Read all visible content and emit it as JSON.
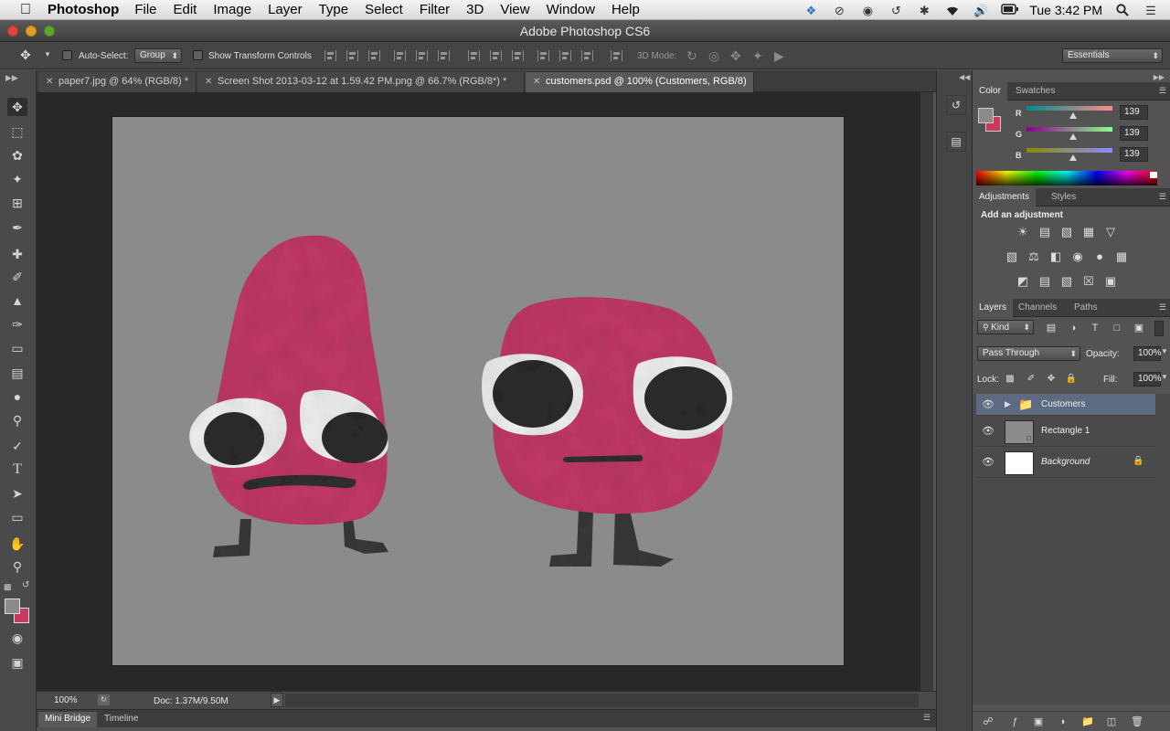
{
  "menubar": {
    "app_name": "Photoshop",
    "items": [
      "File",
      "Edit",
      "Image",
      "Layer",
      "Type",
      "Select",
      "Filter",
      "3D",
      "View",
      "Window",
      "Help"
    ],
    "clock": "Tue 3:42 PM"
  },
  "window": {
    "title": "Adobe Photoshop CS6"
  },
  "options": {
    "auto_select_label": "Auto-Select:",
    "auto_select_value": "Group",
    "transform_label": "Show Transform Controls",
    "mode_3d_label": "3D Mode:",
    "workspace": "Essentials"
  },
  "doc_tabs": [
    {
      "label": "paper7.jpg @ 64% (RGB/8) *"
    },
    {
      "label": "Screen Shot 2013-03-12 at 1.59.42 PM.png @ 66.7% (RGB/8*) *"
    },
    {
      "label": "customers.psd @ 100% (Customers, RGB/8)"
    }
  ],
  "status": {
    "zoom": "100%",
    "doc_info": "Doc: 1.37M/9.50M"
  },
  "bottom_tabs": [
    "Mini Bridge",
    "Timeline"
  ],
  "colors": {
    "foreground": "#8b8b8b",
    "background": "#c9385f",
    "canvas_bg": "#8b8b8b",
    "character": "#c23b66"
  },
  "color_panel": {
    "tabs": [
      "Color",
      "Swatches"
    ],
    "r_label": "R",
    "g_label": "G",
    "b_label": "B",
    "r": "139",
    "g": "139",
    "b": "139",
    "r_fraction": 0.545,
    "g_fraction": 0.545,
    "b_fraction": 0.545
  },
  "adjustments_panel": {
    "tabs": [
      "Adjustments",
      "Styles"
    ],
    "heading": "Add an adjustment"
  },
  "layers_panel": {
    "tabs": [
      "Layers",
      "Channels",
      "Paths"
    ],
    "filter_kind": "Kind",
    "blend_mode": "Pass Through",
    "opacity_label": "Opacity:",
    "opacity": "100%",
    "lock_label": "Lock:",
    "fill_label": "Fill:",
    "fill": "100%",
    "layers": [
      {
        "name": "Customers"
      },
      {
        "name": "Rectangle 1"
      },
      {
        "name": "Background"
      }
    ]
  }
}
